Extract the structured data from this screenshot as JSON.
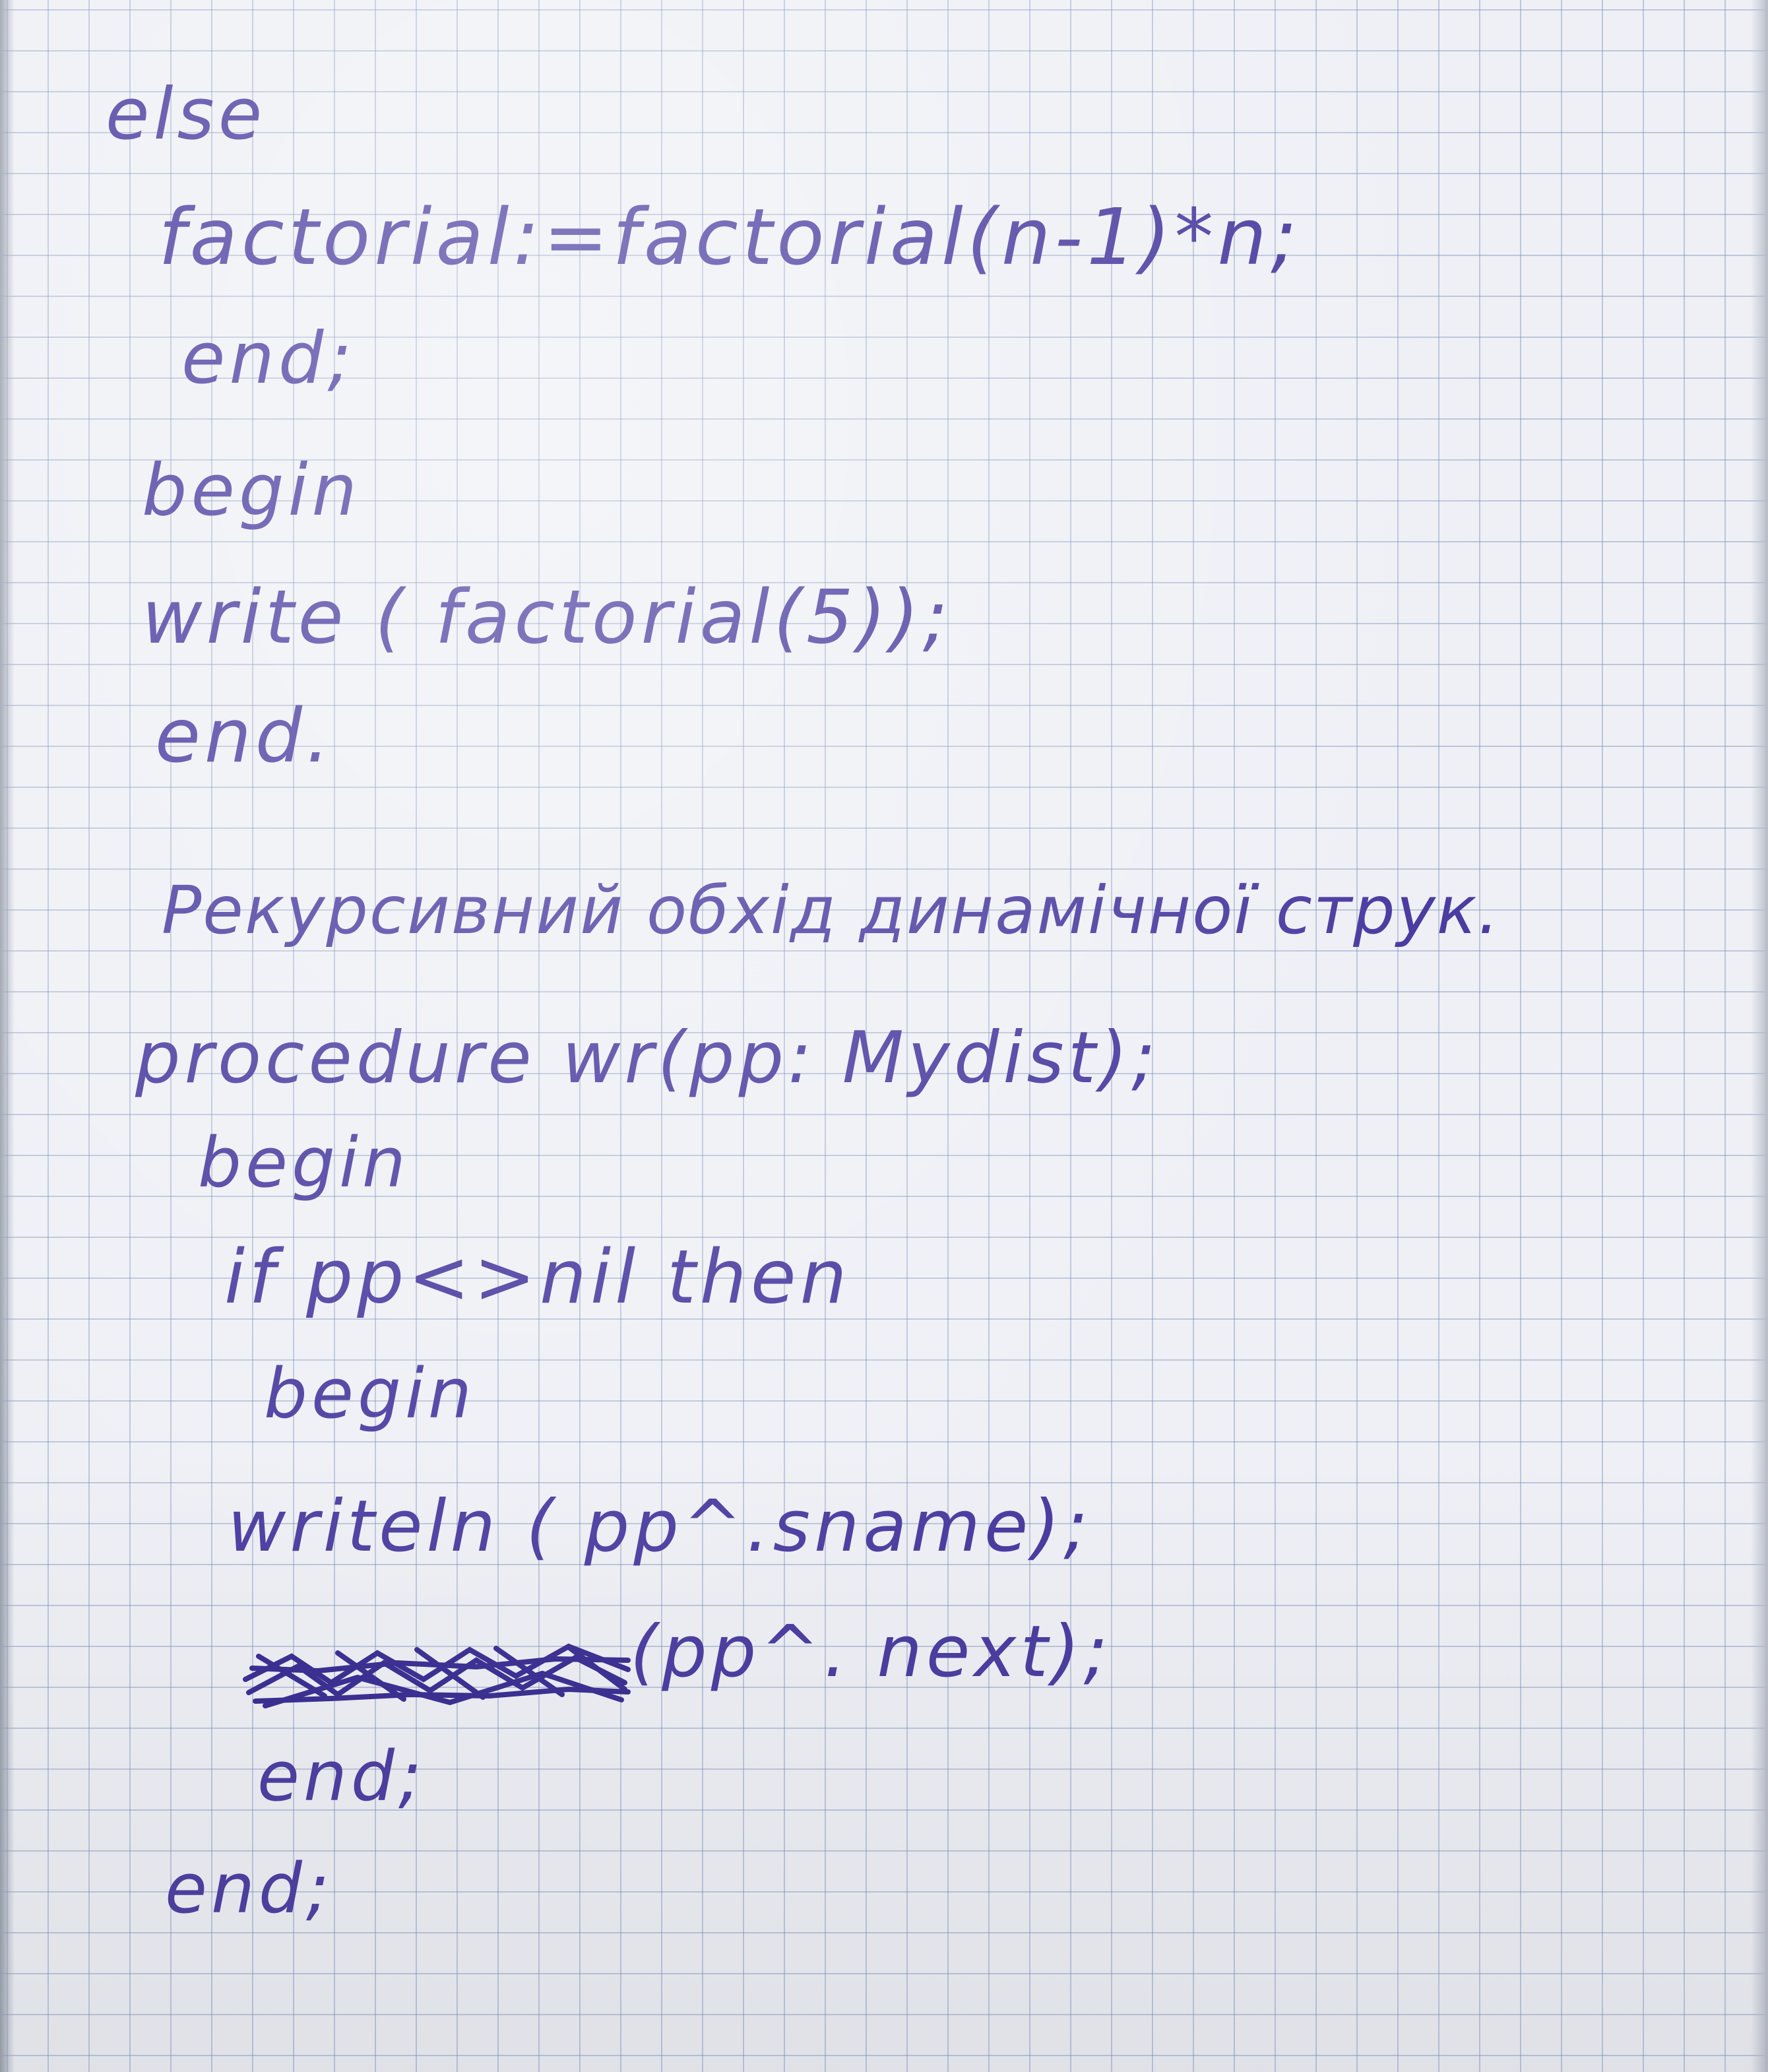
{
  "notebook": {
    "ink_color": "#4a3ca0",
    "paper_color": "#eef0f5",
    "grid_color": "#8fa0c8",
    "lines": [
      "else",
      "factorial:=factorial(n-1)*n;",
      "end;",
      "begin",
      "write ( factorial(5));",
      "end.",
      "Рекурсивний обхід динамічної струк.",
      "procedure wr(pp: Mydist);",
      "begin",
      "if pp<>nil then",
      "begin",
      "writeln ( pp^.sname);",
      "(pp^. next);",
      "end;",
      "end;"
    ],
    "crossed_out_icon": "scribble-icon"
  }
}
